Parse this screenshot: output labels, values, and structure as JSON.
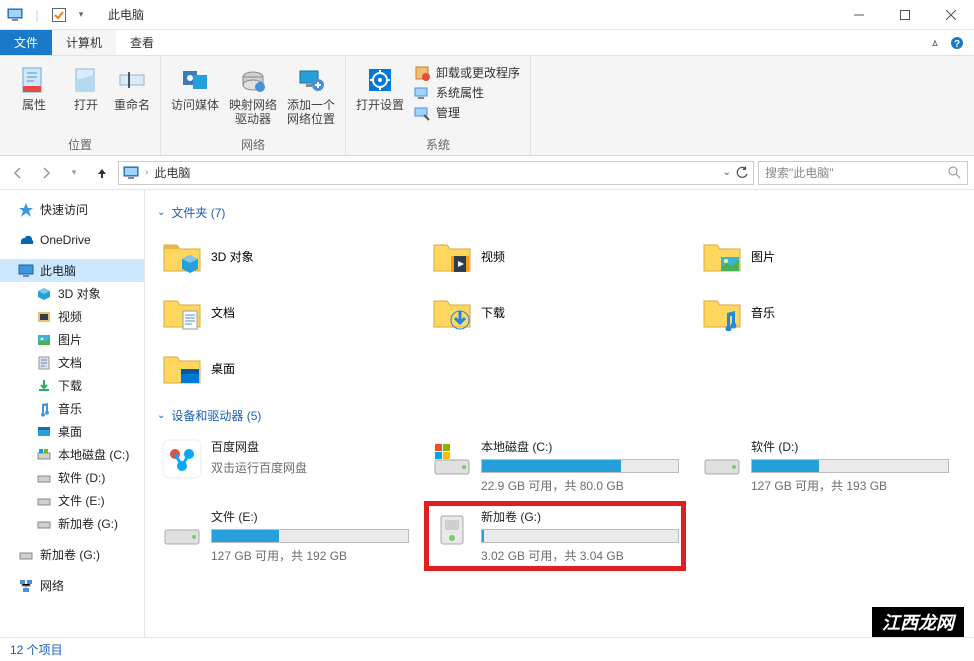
{
  "window": {
    "title": "此电脑"
  },
  "tabs": {
    "file": "文件",
    "computer": "计算机",
    "view": "查看"
  },
  "ribbon": {
    "group_location": "位置",
    "group_network": "网络",
    "group_system": "系统",
    "btn_properties": "属性",
    "btn_open": "打开",
    "btn_rename": "重命名",
    "btn_access_media": "访问媒体",
    "btn_map_drive": "映射网络驱动器",
    "btn_add_location": "添加一个网络位置",
    "btn_open_settings": "打开设置",
    "item_uninstall": "卸载或更改程序",
    "item_sys_props": "系统属性",
    "item_manage": "管理"
  },
  "address": {
    "crumb": "此电脑"
  },
  "search": {
    "placeholder": "搜索\"此电脑\""
  },
  "sidebar": {
    "quick_access": "快速访问",
    "onedrive": "OneDrive",
    "this_pc": "此电脑",
    "objects_3d": "3D 对象",
    "videos": "视频",
    "pictures": "图片",
    "documents": "文档",
    "downloads": "下载",
    "music": "音乐",
    "desktop": "桌面",
    "drive_c": "本地磁盘 (C:)",
    "drive_d": "软件 (D:)",
    "drive_e": "文件 (E:)",
    "drive_g": "新加卷 (G:)",
    "drive_g2": "新加卷 (G:)",
    "network": "网络"
  },
  "sections": {
    "folders": "文件夹 (7)",
    "drives": "设备和驱动器 (5)"
  },
  "folders": {
    "objects_3d": "3D 对象",
    "videos": "视频",
    "pictures": "图片",
    "documents": "文档",
    "downloads": "下载",
    "music": "音乐",
    "desktop": "桌面"
  },
  "drives": {
    "baidu": {
      "name": "百度网盘",
      "sub": "双击运行百度网盘"
    },
    "c": {
      "name": "本地磁盘 (C:)",
      "stats": "22.9 GB 可用，共 80.0 GB",
      "fill": 71
    },
    "d": {
      "name": "软件 (D:)",
      "stats": "127 GB 可用，共 193 GB",
      "fill": 34
    },
    "e": {
      "name": "文件 (E:)",
      "stats": "127 GB 可用，共 192 GB",
      "fill": 34
    },
    "g": {
      "name": "新加卷 (G:)",
      "stats": "3.02 GB 可用，共 3.04 GB",
      "fill": 1
    }
  },
  "statusbar": {
    "count": "12 个项目"
  },
  "watermark": "江西龙网"
}
